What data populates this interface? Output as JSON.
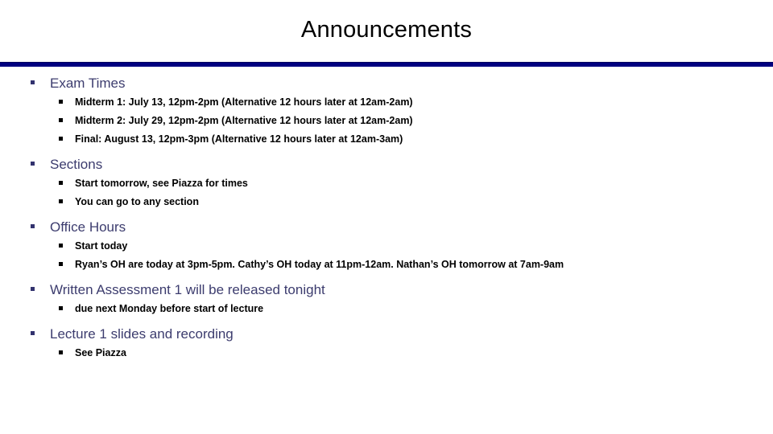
{
  "slide": {
    "title": "Announcements",
    "accent_color": "#000080",
    "heading_color": "#3c3c6e",
    "body_color": "#000000",
    "sections": [
      {
        "heading": "Exam Times",
        "items": [
          "Midterm 1: July 13, 12pm-2pm (Alternative 12 hours later at 12am-2am)",
          "Midterm 2: July 29, 12pm-2pm (Alternative 12 hours later at 12am-2am)",
          "Final: August 13, 12pm-3pm (Alternative 12 hours later at 12am-3am)"
        ]
      },
      {
        "heading": "Sections",
        "items": [
          "Start tomorrow, see Piazza for times",
          "You can go to any section"
        ]
      },
      {
        "heading": "Office Hours",
        "items": [
          "Start today",
          "Ryan’s OH are today at 3pm-5pm. Cathy’s OH today at 11pm-12am. Nathan’s OH tomorrow at 7am-9am"
        ]
      },
      {
        "heading": "Written Assessment 1 will be released tonight",
        "items": [
          "due next Monday before start of lecture"
        ]
      },
      {
        "heading": "Lecture 1 slides and recording",
        "items": [
          "See Piazza"
        ]
      }
    ]
  }
}
